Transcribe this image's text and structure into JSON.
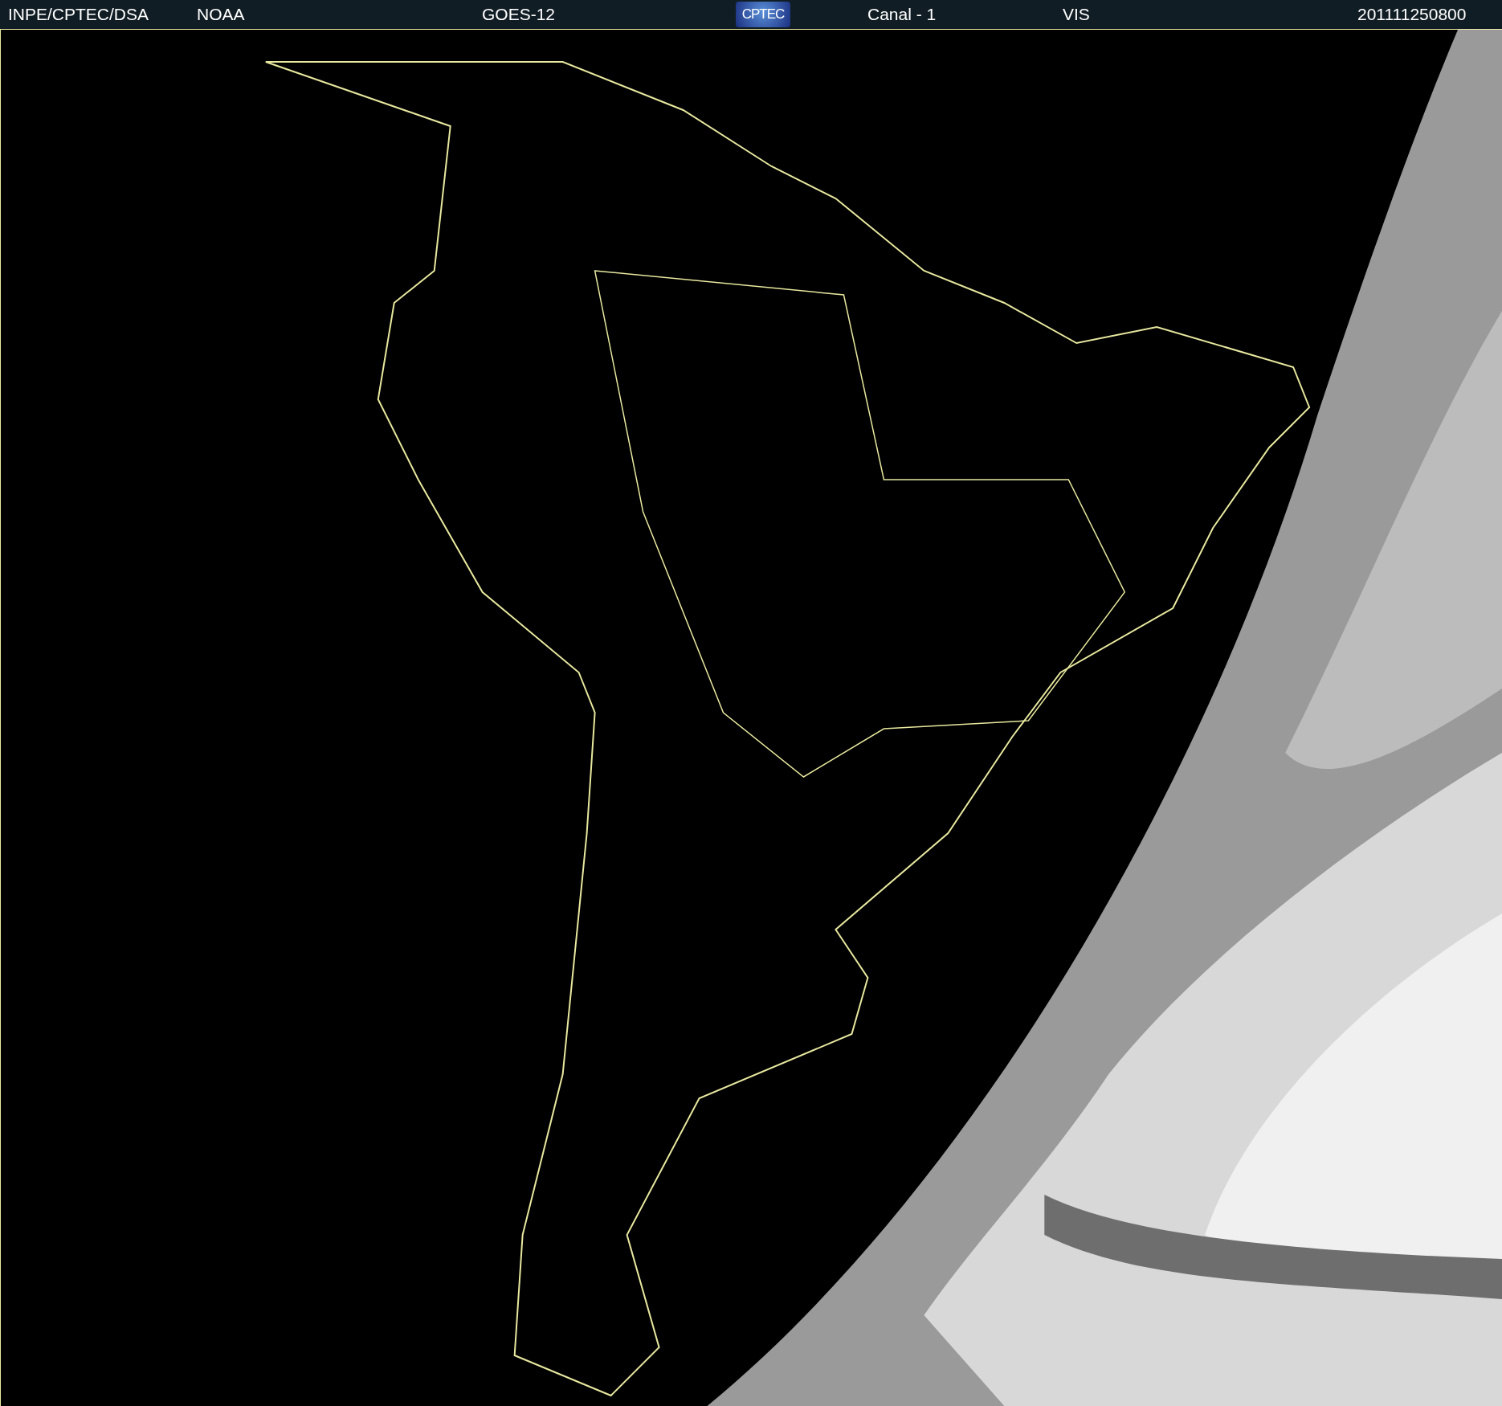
{
  "header": {
    "source": "INPE/CPTEC/DSA",
    "agency": "NOAA",
    "satellite": "GOES-12",
    "logo": "CPTEC",
    "channel": "Canal - 1",
    "band": "VIS",
    "timestamp": "201111250800"
  }
}
